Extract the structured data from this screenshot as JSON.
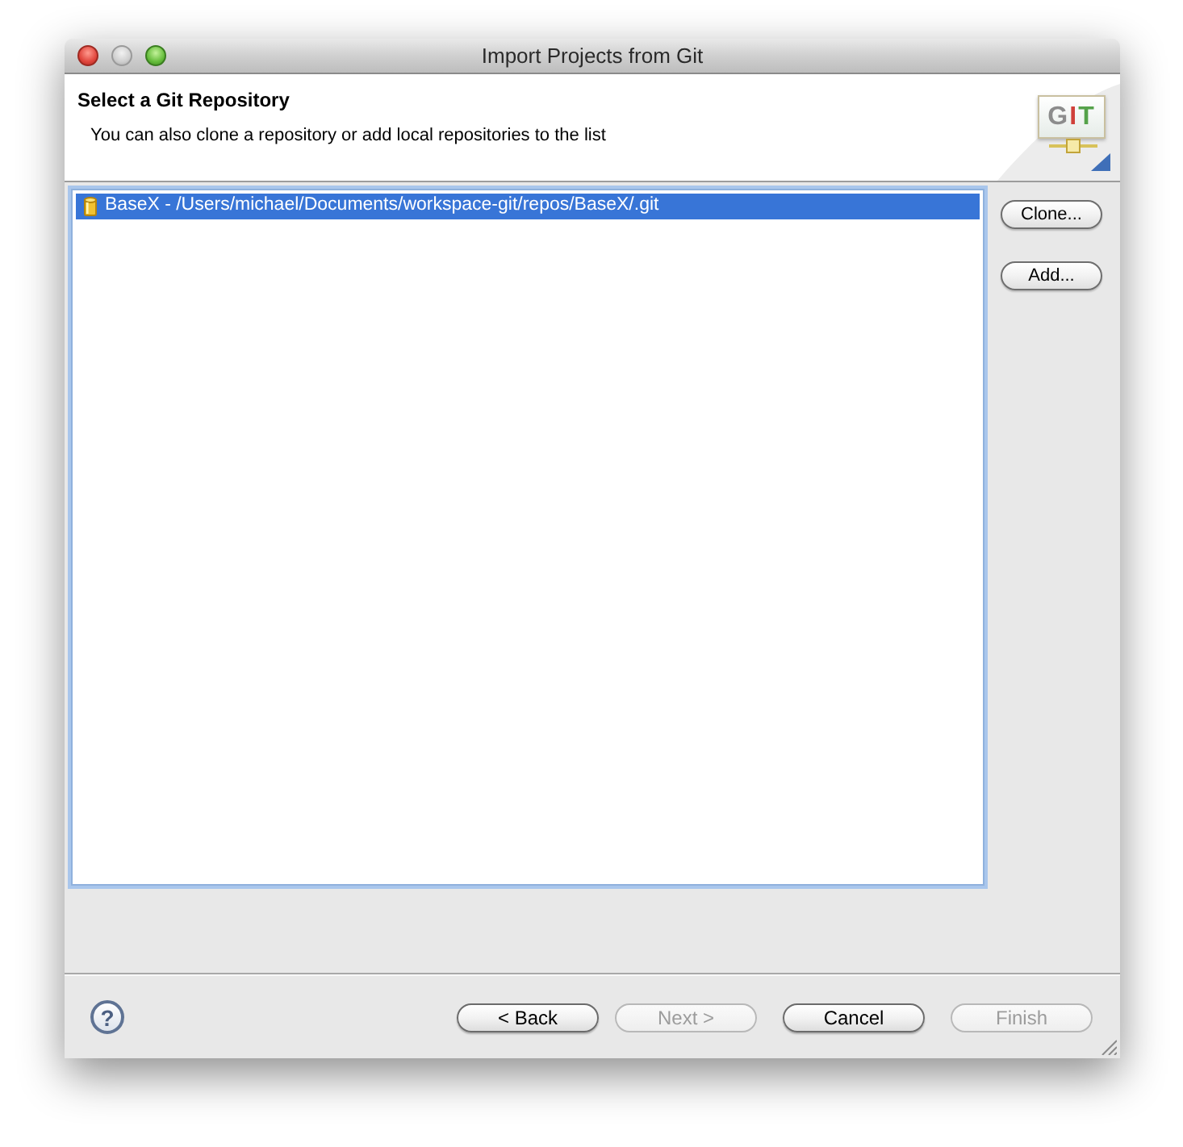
{
  "window": {
    "title": "Import Projects from Git",
    "buttons": [
      {
        "kind": "close",
        "disabled": false
      },
      {
        "kind": "minimize",
        "disabled": true
      },
      {
        "kind": "zoom",
        "disabled": false
      }
    ]
  },
  "header": {
    "title": "Select a Git Repository",
    "description": "You can also clone a repository or add local repositories to the list",
    "logo_text": "GIT"
  },
  "repositories": [
    {
      "label": "BaseX - /Users/michael/Documents/workspace-git/repos/BaseX/.git",
      "selected": true
    }
  ],
  "side_buttons": [
    {
      "label": "Clone..."
    },
    {
      "label": "Add..."
    }
  ],
  "footer": {
    "help_label": "?",
    "buttons": [
      {
        "label": "< Back",
        "disabled": false
      },
      {
        "label": "Next >",
        "disabled": true
      },
      {
        "label": "Cancel",
        "disabled": false
      },
      {
        "label": "Finish",
        "disabled": true
      }
    ]
  }
}
